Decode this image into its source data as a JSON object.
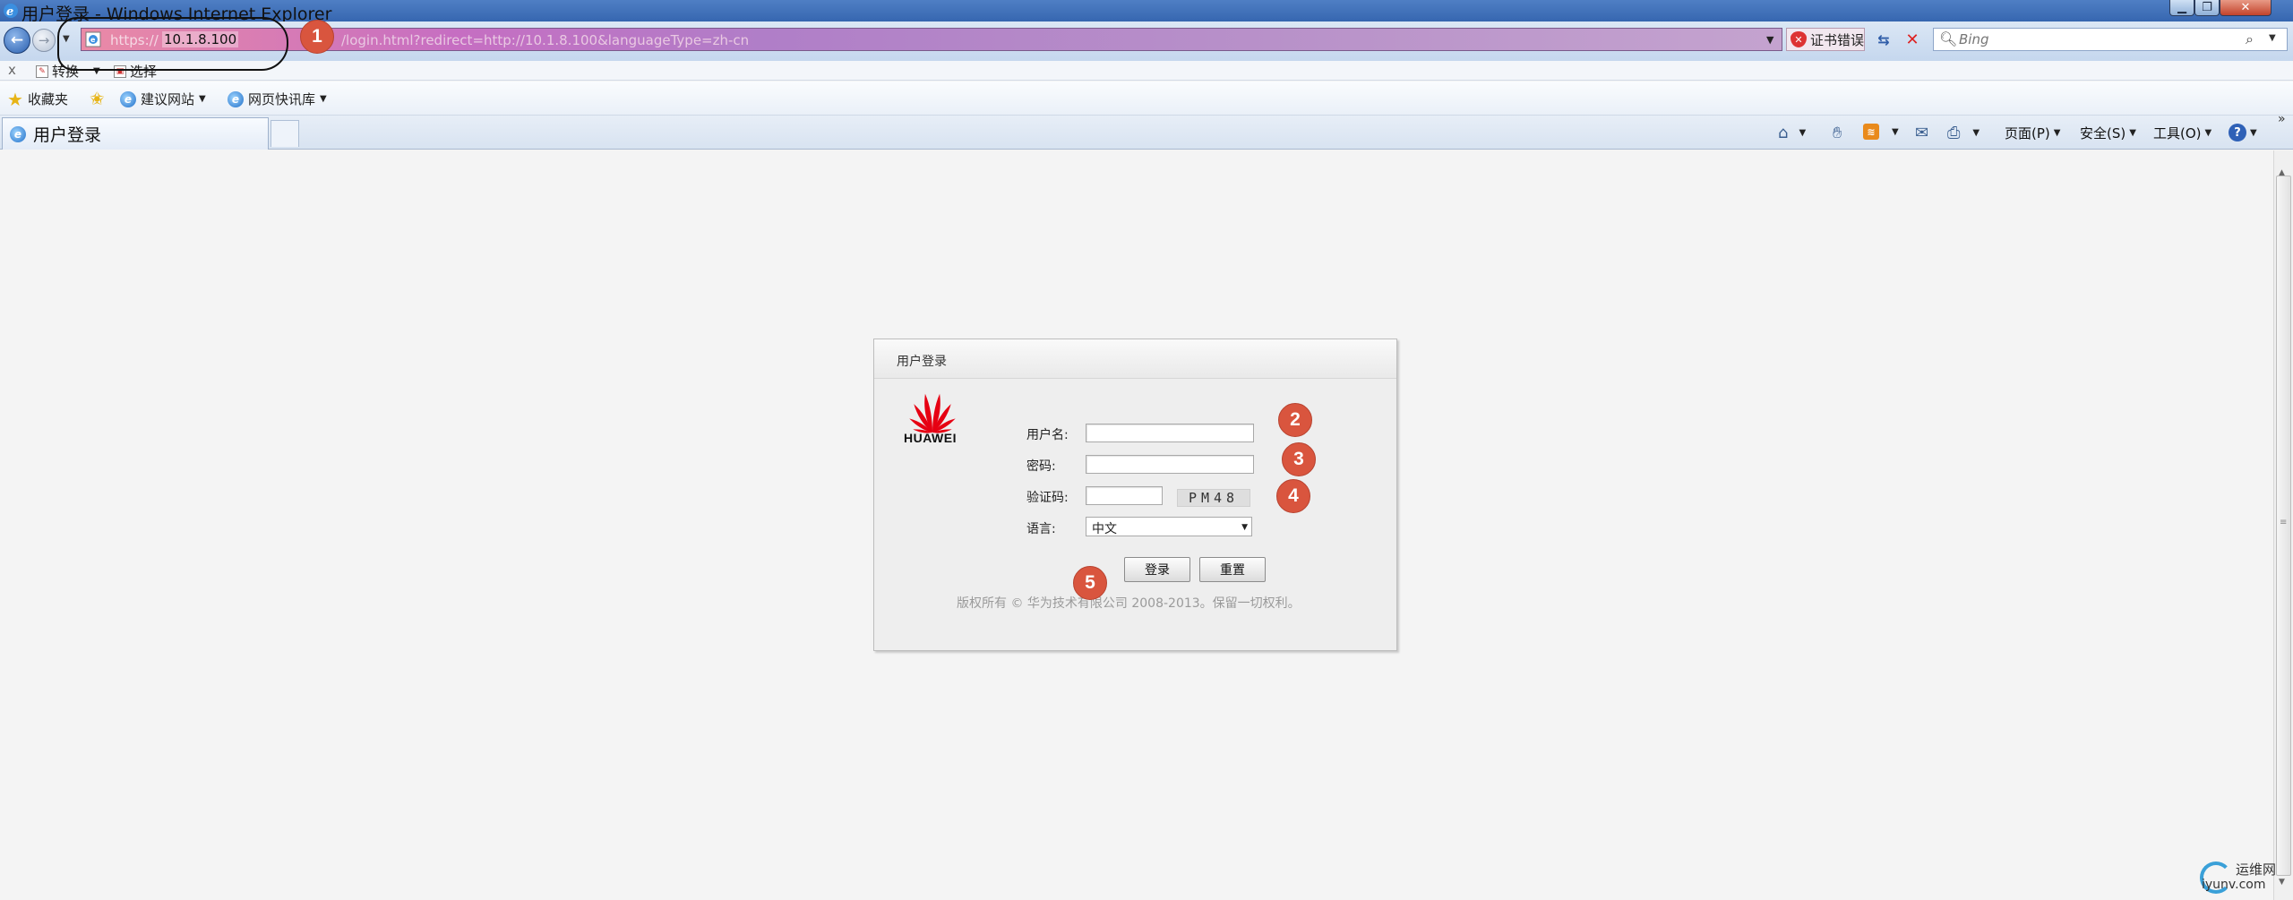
{
  "window": {
    "title": "用户登录 - Windows Internet Explorer"
  },
  "address_bar": {
    "scheme": "https://",
    "host": "10.1.8.100",
    "rest": "/login.html?redirect=http://10.1.8.100&languageType=zh-cn",
    "certificate_error": "证书错误"
  },
  "search": {
    "placeholder": "Bing"
  },
  "translator": {
    "close": "x",
    "convert": "转换",
    "select": "选择"
  },
  "favorites": {
    "label": "收藏夹",
    "items": [
      "建议网站",
      "网页快讯库"
    ]
  },
  "tab": {
    "title": "用户登录"
  },
  "commands": {
    "page": "页面(P)",
    "safety": "安全(S)",
    "tools": "工具(O)"
  },
  "login": {
    "header": "用户登录",
    "brand": "HUAWEI",
    "username_label": "用户名:",
    "password_label": "密码:",
    "captcha_label": "验证码:",
    "captcha_code": "PM48",
    "language_label": "语言:",
    "language_value": "中文",
    "login_button": "登录",
    "reset_button": "重置",
    "copyright": "版权所有 © 华为技术有限公司 2008-2013。保留一切权利。"
  },
  "markers": [
    "1",
    "2",
    "3",
    "4",
    "5"
  ],
  "watermark": {
    "line1": "运维网",
    "line2": "iyunv.com"
  },
  "colors": {
    "marker": "#d9553e",
    "huawei_red": "#e60012",
    "address_pink": "#c66ec2"
  },
  "icons": {
    "back": "back-arrow-icon",
    "forward": "forward-arrow-icon",
    "favorites": "star-icon",
    "home": "home-icon",
    "rss": "rss-icon",
    "print": "printer-icon",
    "help": "help-icon"
  }
}
